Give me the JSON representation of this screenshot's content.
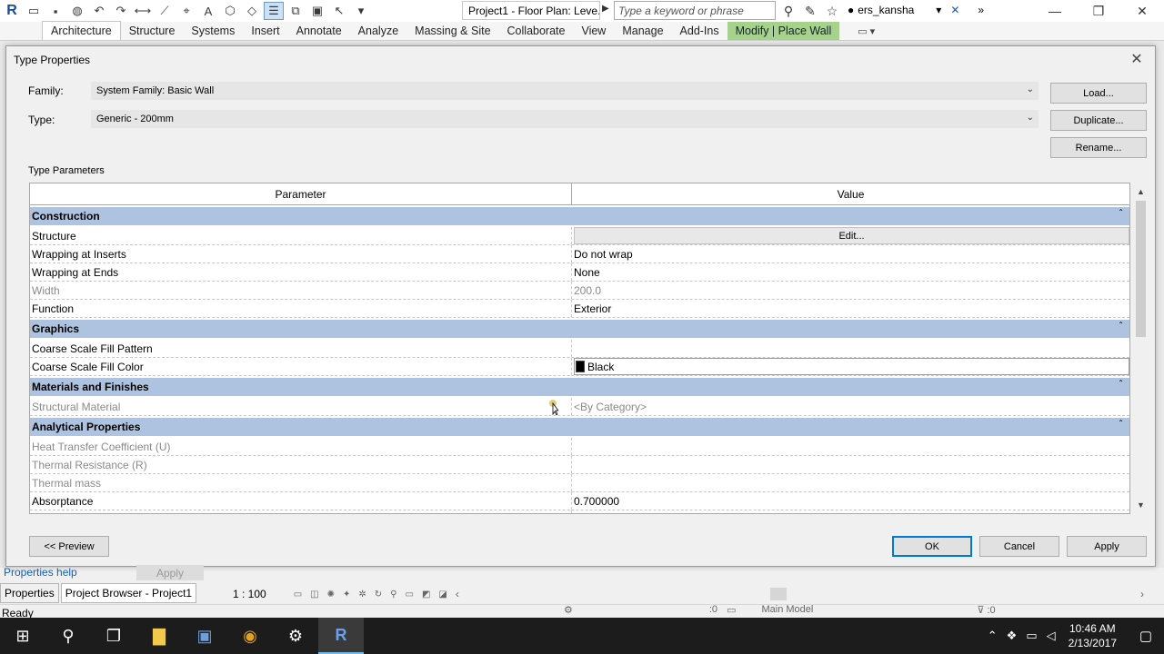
{
  "app": {
    "doc_title": "Project1 - Floor Plan: Leve...",
    "search_placeholder": "Type a keyword or phrase",
    "user": "ers_kansha"
  },
  "ribbon": {
    "tabs": [
      "Architecture",
      "Structure",
      "Systems",
      "Insert",
      "Annotate",
      "Analyze",
      "Massing & Site",
      "Collaborate",
      "View",
      "Manage",
      "Add-Ins",
      "Modify | Place Wall"
    ],
    "active": "Architecture"
  },
  "dialog": {
    "title": "Type Properties",
    "family_label": "Family:",
    "family_value": "System Family: Basic Wall",
    "type_label": "Type:",
    "type_value": "Generic - 200mm",
    "load_btn": "Load...",
    "duplicate_btn": "Duplicate...",
    "rename_btn": "Rename...",
    "params_label": "Type Parameters",
    "col_param": "Parameter",
    "col_value": "Value",
    "groups": {
      "construction": "Construction",
      "graphics": "Graphics",
      "materials": "Materials and Finishes",
      "analytical": "Analytical Properties"
    },
    "rows": {
      "structure": {
        "p": "Structure",
        "v": "Edit..."
      },
      "wrap_inserts": {
        "p": "Wrapping at Inserts",
        "v": "Do not wrap"
      },
      "wrap_ends": {
        "p": "Wrapping at Ends",
        "v": "None"
      },
      "width": {
        "p": "Width",
        "v": "200.0"
      },
      "function": {
        "p": "Function",
        "v": "Exterior"
      },
      "fill_pattern": {
        "p": "Coarse Scale Fill Pattern",
        "v": ""
      },
      "fill_color": {
        "p": "Coarse Scale Fill Color",
        "v": "Black"
      },
      "struct_material": {
        "p": "Structural Material",
        "v": "<By Category>"
      },
      "heat_transfer": {
        "p": "Heat Transfer Coefficient (U)",
        "v": ""
      },
      "thermal_res": {
        "p": "Thermal Resistance (R)",
        "v": ""
      },
      "thermal_mass": {
        "p": "Thermal mass",
        "v": ""
      },
      "absorptance": {
        "p": "Absorptance",
        "v": "0.700000"
      }
    },
    "preview_btn": "<< Preview",
    "ok_btn": "OK",
    "cancel_btn": "Cancel",
    "apply_btn": "Apply"
  },
  "bottom": {
    "props_help": "Properties help",
    "apply": "Apply",
    "tab_properties": "Properties",
    "tab_browser": "Project Browser - Project1",
    "scale": "1 : 100",
    "status": "Ready",
    "main_model": "Main Model",
    "zero": ":0"
  },
  "taskbar": {
    "time": "10:46 AM",
    "date": "2/13/2017"
  },
  "colors": {
    "group_header": "#aec3e0",
    "contextual_tab": "#a6d28c",
    "taskbar": "#1c1c1c"
  }
}
